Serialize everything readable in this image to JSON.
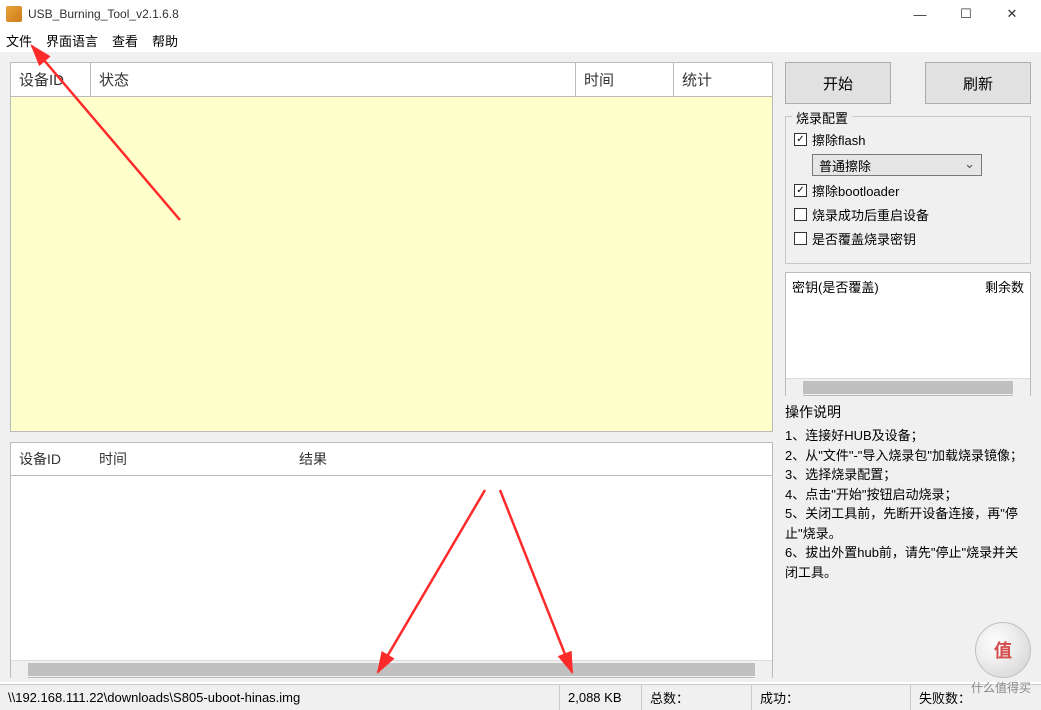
{
  "window": {
    "title": "USB_Burning_Tool_v2.1.6.8"
  },
  "menu": {
    "file": "文件",
    "language": "界面语言",
    "view": "查看",
    "help": "帮助"
  },
  "top_grid": {
    "cols": {
      "device_id": "设备ID",
      "status": "状态",
      "time": "时间",
      "stats": "统计"
    }
  },
  "bottom_grid": {
    "cols": {
      "device_id": "设备ID",
      "time": "时间",
      "result": "结果"
    }
  },
  "buttons": {
    "start": "开始",
    "refresh": "刷新"
  },
  "config": {
    "legend": "烧录配置",
    "erase_flash": "擦除flash",
    "erase_mode": "普通擦除",
    "erase_bootloader": "擦除bootloader",
    "reboot_after": "烧录成功后重启设备",
    "overwrite_key": "是否覆盖烧录密钥"
  },
  "key_table": {
    "col1": "密钥(是否覆盖)",
    "col2": "剩余数"
  },
  "instructions": {
    "title": "操作说明",
    "lines": [
      "1、连接好HUB及设备；",
      "2、从\"文件\"-\"导入烧录包\"加载烧录镜像；",
      "3、选择烧录配置；",
      "4、点击\"开始\"按钮启动烧录；",
      "5、关闭工具前，先断开设备连接，再\"停止\"烧录。",
      "6、拔出外置hub前，请先\"停止\"烧录并关闭工具。"
    ]
  },
  "statusbar": {
    "path": "\\\\192.168.111.22\\downloads\\S805-uboot-hinas.img",
    "size": "2,088 KB",
    "total_label": "总数：",
    "success_label": "成功：",
    "fail_label": "失败数："
  },
  "watermark": {
    "badge": "值",
    "text": "什么值得买"
  }
}
